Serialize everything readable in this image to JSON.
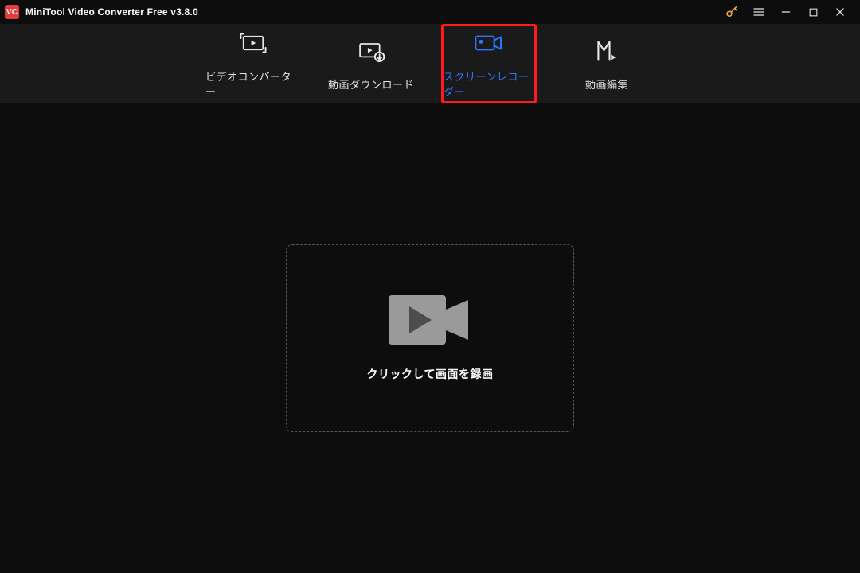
{
  "app": {
    "logo_text": "VC",
    "title": "MiniTool Video Converter Free v3.8.0"
  },
  "tabs": {
    "convert": {
      "label": "ビデオコンバーター"
    },
    "download": {
      "label": "動画ダウンロード"
    },
    "recorder": {
      "label": "スクリーンレコーダー"
    },
    "editor": {
      "label": "動画編集"
    }
  },
  "main": {
    "record_prompt": "クリックして画面を録画"
  }
}
